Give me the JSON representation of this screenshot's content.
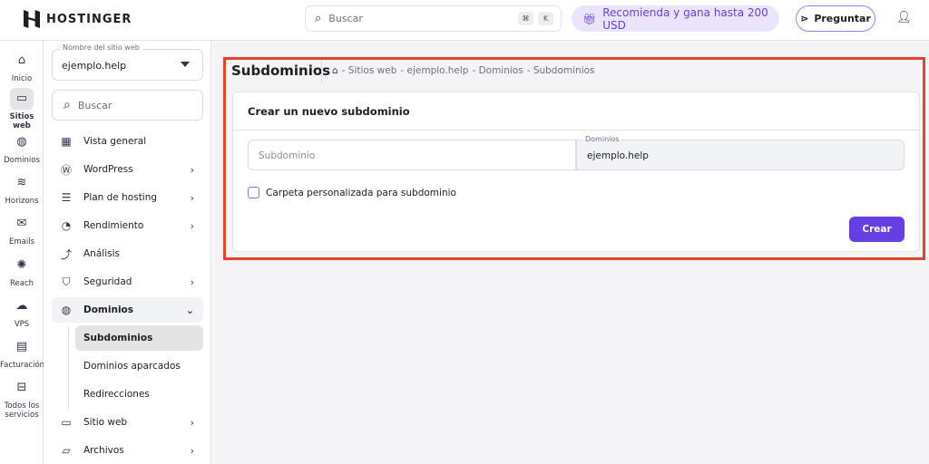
{
  "header": {
    "brand": "HOSTINGER",
    "search_placeholder": "Buscar",
    "kbd1": "⌘",
    "kbd2": "K",
    "promo": "Recomienda y gana hasta 200 USD",
    "ask": "Preguntar"
  },
  "rail": [
    {
      "label": "Inicio",
      "icon": "⌂"
    },
    {
      "label": "Sitios web",
      "icon": "▭"
    },
    {
      "label": "Dominios",
      "icon": "◍"
    },
    {
      "label": "Horizons",
      "icon": "≋"
    },
    {
      "label": "Emails",
      "icon": "✉"
    },
    {
      "label": "Reach",
      "icon": "✺"
    },
    {
      "label": "VPS",
      "icon": "☁"
    },
    {
      "label": "Facturación",
      "icon": "▤"
    },
    {
      "label": "Todos los servicios",
      "icon": "⊟"
    }
  ],
  "sidebar": {
    "site_label": "Nombre del sitio web",
    "site_value": "ejemplo.help",
    "search_placeholder": "Buscar",
    "items": [
      {
        "label": "Vista general",
        "icon": "▦"
      },
      {
        "label": "WordPress",
        "icon": "Ⓦ",
        "chev": "›"
      },
      {
        "label": "Plan de hosting",
        "icon": "☰",
        "chev": "›"
      },
      {
        "label": "Rendimiento",
        "icon": "◔",
        "chev": "›"
      },
      {
        "label": "Análisis",
        "icon": "⤴"
      },
      {
        "label": "Seguridad",
        "icon": "⛉",
        "chev": "›"
      },
      {
        "label": "Dominios",
        "icon": "◍",
        "chev": "⌄"
      }
    ],
    "subitems": [
      "Subdominios",
      "Dominios aparcados",
      "Redirecciones"
    ],
    "items2": [
      {
        "label": "Sitio web",
        "icon": "▭",
        "chev": "›"
      },
      {
        "label": "Archivos",
        "icon": "▱",
        "chev": "›"
      }
    ]
  },
  "main": {
    "title": "Subdominios",
    "breadcrumb": [
      "- Sitios web",
      "- ejemplo.help",
      "- Dominios",
      "- Subdominios"
    ],
    "card_title": "Crear un nuevo subdominio",
    "subdomain_placeholder": "Subdominio",
    "domain_label": "Dominios",
    "domain_value": "ejemplo.help",
    "checkbox_label": "Carpeta personalizada para subdominio",
    "create": "Crear"
  }
}
